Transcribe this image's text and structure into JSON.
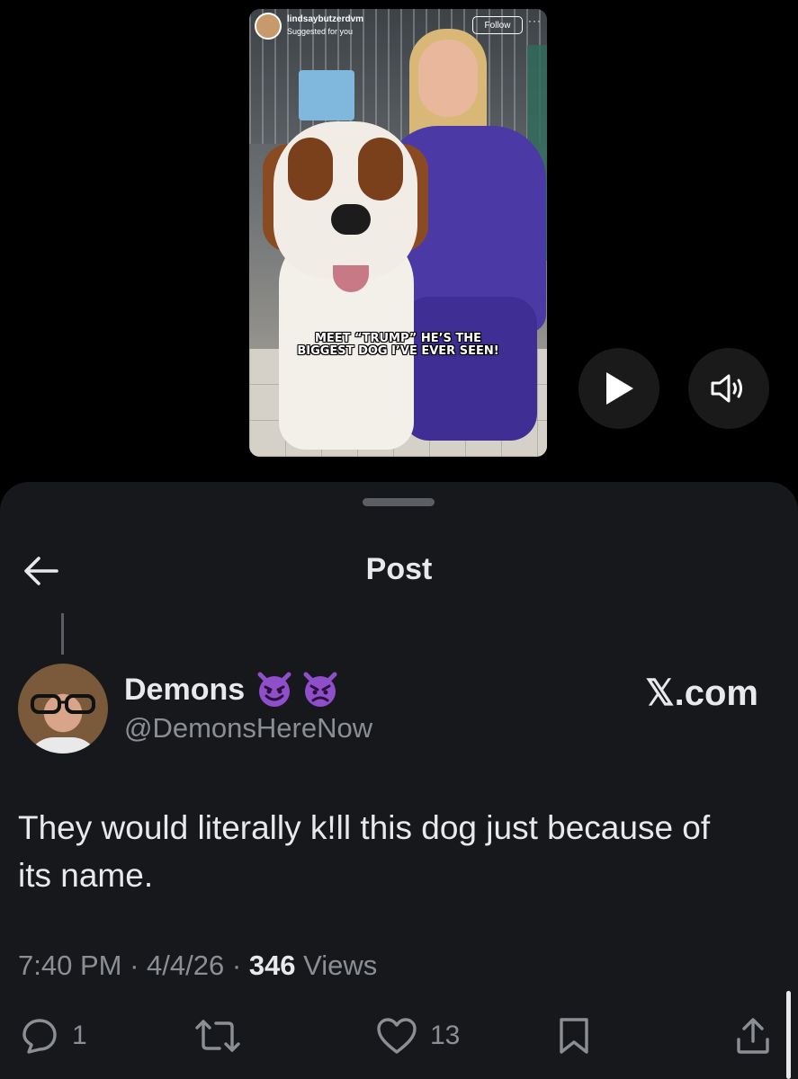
{
  "video": {
    "account": "lindsaybutzerdvm",
    "subtitle": "Suggested for you",
    "follow_label": "Follow",
    "more_label": "···",
    "caption_line1": "MEET “TRUMP” HE’S THE",
    "caption_line2": "BIGGEST DOG I’VE EVER SEEN!"
  },
  "player": {
    "play_icon": "play-icon",
    "sound_icon": "speaker-icon"
  },
  "header": {
    "title": "Post",
    "back_icon": "arrow-left-icon"
  },
  "post": {
    "display_name": "Demons",
    "emojis": [
      "smiling-imp",
      "angry-imp"
    ],
    "handle": "@DemonsHereNow",
    "source": "𝕏.com",
    "text_line1": "They would literally k!ll this dog just because of",
    "text_line2": "its name.",
    "time": "7:40 PM",
    "sep1": "·",
    "date": "4/4/26",
    "sep2": "·",
    "views_count": "346",
    "views_label": "Views"
  },
  "actions": {
    "replies": "1",
    "reposts": "",
    "likes": "13"
  },
  "colors": {
    "background": "#000000",
    "sheet": "#16181c",
    "text_primary": "#e7e9ea",
    "text_secondary": "#8b8f94",
    "emoji_purple": "#8e4fc9"
  }
}
